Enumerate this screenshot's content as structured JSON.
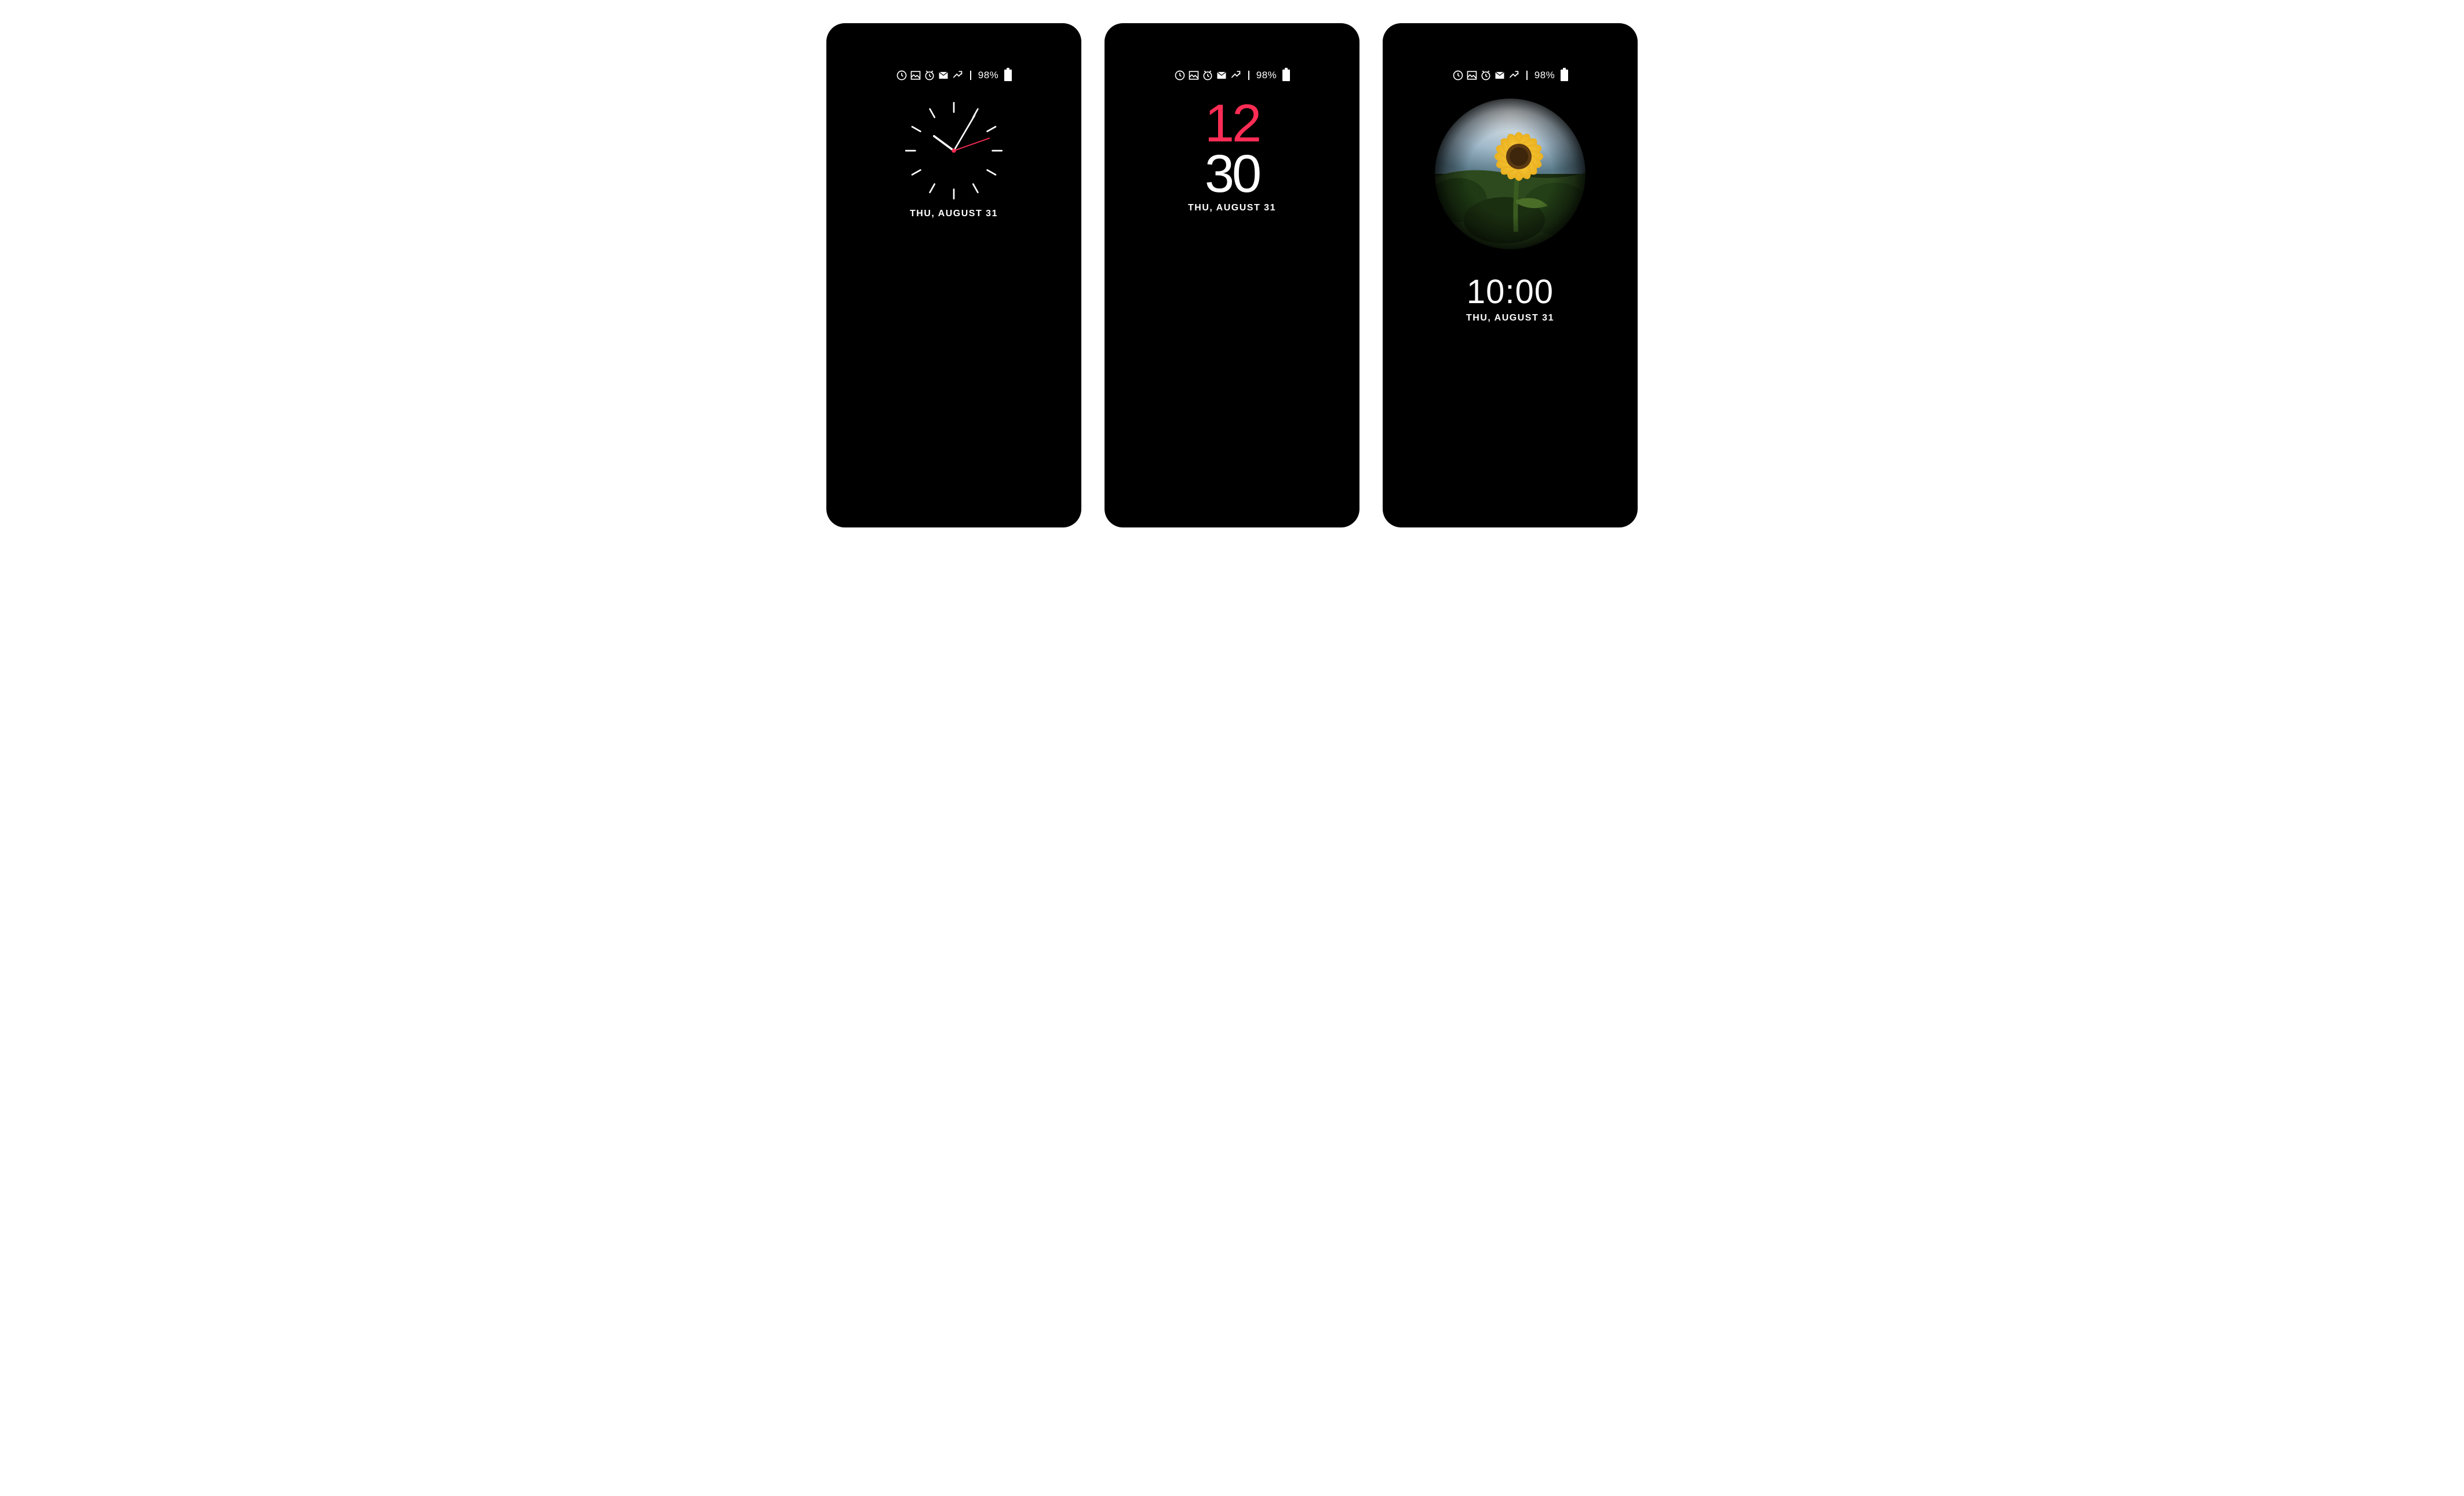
{
  "status": {
    "battery_pct": "98%",
    "icons": [
      "sync-icon",
      "picture-icon",
      "alarm-icon",
      "mail-icon",
      "missed-call-icon"
    ]
  },
  "phone1": {
    "date": "THU, AUGUST 31",
    "analog": {
      "hour": 10,
      "minute": 10
    }
  },
  "phone2": {
    "hour": "12",
    "minute": "30",
    "date": "THU, AUGUST 31"
  },
  "phone3": {
    "time": "10:00",
    "date": "THU, AUGUST 31",
    "image": "sunflower"
  }
}
